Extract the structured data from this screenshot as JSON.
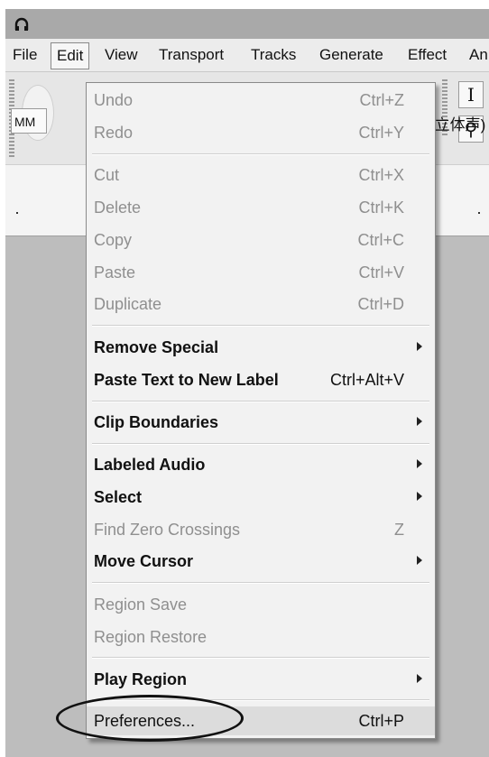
{
  "menubar": {
    "file": "File",
    "edit": "Edit",
    "view": "View",
    "transport": "Transport",
    "tracks": "Tracks",
    "generate": "Generate",
    "effect": "Effect",
    "analyze_partial": "An"
  },
  "toolbar": {
    "device_partial": "MM",
    "channels_partial": "(立体声)",
    "selection_tool_icon": "I",
    "zoom_tool_icon": "⚲"
  },
  "edit_menu": {
    "undo": {
      "label": "Undo",
      "shortcut": "Ctrl+Z"
    },
    "redo": {
      "label": "Redo",
      "shortcut": "Ctrl+Y"
    },
    "cut": {
      "label": "Cut",
      "shortcut": "Ctrl+X"
    },
    "delete": {
      "label": "Delete",
      "shortcut": "Ctrl+K"
    },
    "copy": {
      "label": "Copy",
      "shortcut": "Ctrl+C"
    },
    "paste": {
      "label": "Paste",
      "shortcut": "Ctrl+V"
    },
    "duplicate": {
      "label": "Duplicate",
      "shortcut": "Ctrl+D"
    },
    "remove_special": {
      "label": "Remove Special"
    },
    "paste_text_new_label": {
      "label": "Paste Text to New Label",
      "shortcut": "Ctrl+Alt+V"
    },
    "clip_boundaries": {
      "label": "Clip Boundaries"
    },
    "labeled_audio": {
      "label": "Labeled Audio"
    },
    "select": {
      "label": "Select"
    },
    "find_zero_crossings": {
      "label": "Find Zero Crossings",
      "shortcut": "Z"
    },
    "move_cursor": {
      "label": "Move Cursor"
    },
    "region_save": {
      "label": "Region Save"
    },
    "region_restore": {
      "label": "Region Restore"
    },
    "play_region": {
      "label": "Play Region"
    },
    "preferences": {
      "label": "Preferences...",
      "shortcut": "Ctrl+P"
    }
  }
}
